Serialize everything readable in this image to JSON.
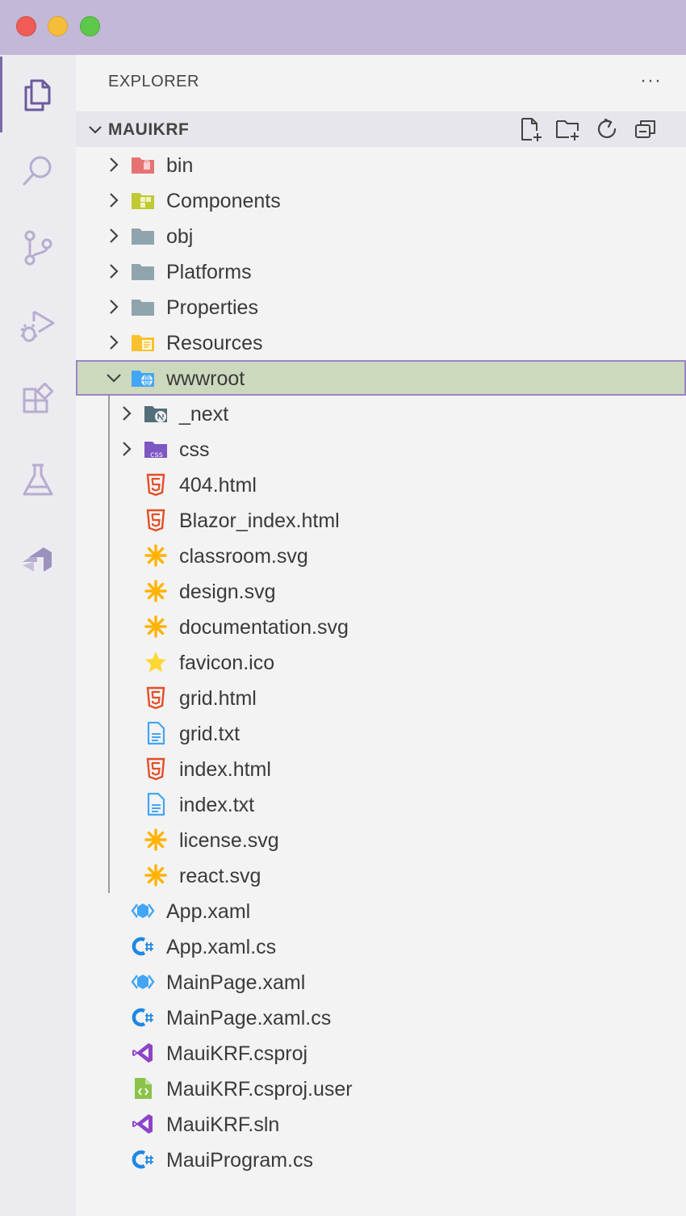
{
  "window": {
    "traffic_lights": [
      "close",
      "minimize",
      "zoom"
    ]
  },
  "activity_bar": {
    "items": [
      {
        "name": "explorer-icon",
        "active": true
      },
      {
        "name": "search-icon",
        "active": false
      },
      {
        "name": "source-control-icon",
        "active": false
      },
      {
        "name": "run-debug-icon",
        "active": false
      },
      {
        "name": "extensions-icon",
        "active": false
      },
      {
        "name": "testing-icon",
        "active": false
      },
      {
        "name": "extension-panel-icon",
        "active": false
      }
    ]
  },
  "sidebar": {
    "title": "EXPLORER",
    "more_label": "···",
    "section": {
      "title": "MAUIKRF",
      "actions": [
        "new-file-icon",
        "new-folder-icon",
        "refresh-icon",
        "collapse-all-icon"
      ]
    },
    "tree": [
      {
        "label": "bin",
        "type": "folder",
        "icon": "folder-bin-icon",
        "depth": 0,
        "expanded": false
      },
      {
        "label": "Components",
        "type": "folder",
        "icon": "folder-components-icon",
        "depth": 0,
        "expanded": false
      },
      {
        "label": "obj",
        "type": "folder",
        "icon": "folder-icon",
        "depth": 0,
        "expanded": false
      },
      {
        "label": "Platforms",
        "type": "folder",
        "icon": "folder-icon",
        "depth": 0,
        "expanded": false
      },
      {
        "label": "Properties",
        "type": "folder",
        "icon": "folder-icon",
        "depth": 0,
        "expanded": false
      },
      {
        "label": "Resources",
        "type": "folder",
        "icon": "folder-resources-icon",
        "depth": 0,
        "expanded": false
      },
      {
        "label": "wwwroot",
        "type": "folder",
        "icon": "folder-web-icon",
        "depth": 0,
        "expanded": true,
        "selected": true
      },
      {
        "label": "_next",
        "type": "folder",
        "icon": "folder-next-icon",
        "depth": 1,
        "expanded": false
      },
      {
        "label": "css",
        "type": "folder",
        "icon": "folder-css-icon",
        "depth": 1,
        "expanded": false
      },
      {
        "label": "404.html",
        "type": "file",
        "icon": "html5-icon",
        "depth": 1
      },
      {
        "label": "Blazor_index.html",
        "type": "file",
        "icon": "html5-icon",
        "depth": 1
      },
      {
        "label": "classroom.svg",
        "type": "file",
        "icon": "svg-icon",
        "depth": 1
      },
      {
        "label": "design.svg",
        "type": "file",
        "icon": "svg-icon",
        "depth": 1
      },
      {
        "label": "documentation.svg",
        "type": "file",
        "icon": "svg-icon",
        "depth": 1
      },
      {
        "label": "favicon.ico",
        "type": "file",
        "icon": "favicon-star-icon",
        "depth": 1
      },
      {
        "label": "grid.html",
        "type": "file",
        "icon": "html5-icon",
        "depth": 1
      },
      {
        "label": "grid.txt",
        "type": "file",
        "icon": "text-file-icon",
        "depth": 1
      },
      {
        "label": "index.html",
        "type": "file",
        "icon": "html5-icon",
        "depth": 1
      },
      {
        "label": "index.txt",
        "type": "file",
        "icon": "text-file-icon",
        "depth": 1
      },
      {
        "label": "license.svg",
        "type": "file",
        "icon": "svg-icon",
        "depth": 1
      },
      {
        "label": "react.svg",
        "type": "file",
        "icon": "svg-icon",
        "depth": 1
      },
      {
        "label": "App.xaml",
        "type": "file",
        "icon": "xaml-icon",
        "depth": 0
      },
      {
        "label": "App.xaml.cs",
        "type": "file",
        "icon": "csharp-icon",
        "depth": 0
      },
      {
        "label": "MainPage.xaml",
        "type": "file",
        "icon": "xaml-icon",
        "depth": 0
      },
      {
        "label": "MainPage.xaml.cs",
        "type": "file",
        "icon": "csharp-icon",
        "depth": 0
      },
      {
        "label": "MauiKRF.csproj",
        "type": "file",
        "icon": "visual-studio-icon",
        "depth": 0
      },
      {
        "label": "MauiKRF.csproj.user",
        "type": "file",
        "icon": "code-file-icon",
        "depth": 0
      },
      {
        "label": "MauiKRF.sln",
        "type": "file",
        "icon": "visual-studio-icon",
        "depth": 0
      },
      {
        "label": "MauiProgram.cs",
        "type": "file",
        "icon": "csharp-icon",
        "depth": 0
      }
    ]
  }
}
